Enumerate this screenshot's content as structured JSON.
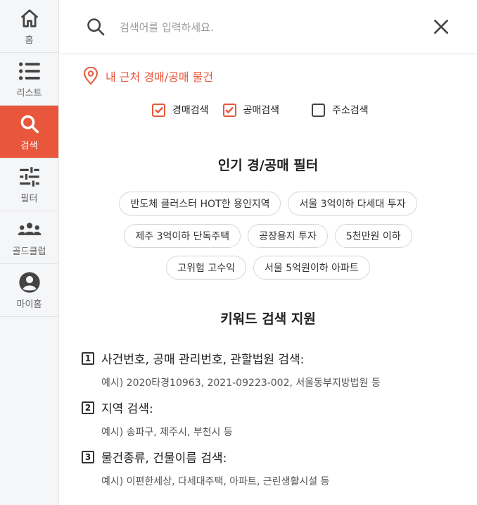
{
  "sidebar": {
    "items": [
      {
        "label": "홈",
        "icon": "home-icon"
      },
      {
        "label": "리스트",
        "icon": "list-icon"
      },
      {
        "label": "검색",
        "icon": "search-icon",
        "active": true
      },
      {
        "label": "필터",
        "icon": "filter-sliders-icon"
      },
      {
        "label": "골드클럽",
        "icon": "group-icon"
      },
      {
        "label": "마이홈",
        "icon": "user-circle-icon"
      }
    ],
    "accent_color": "#e8573c"
  },
  "search": {
    "placeholder": "검색어를 입력하세요.",
    "value": ""
  },
  "nearby": {
    "label": "내 근처 경매/공매 물건"
  },
  "checkboxes": [
    {
      "label": "경매검색",
      "checked": true
    },
    {
      "label": "공매검색",
      "checked": true
    },
    {
      "label": "주소검색",
      "checked": false
    }
  ],
  "popular": {
    "title": "인기 경/공매 필터",
    "chips": [
      [
        "반도체 클러스터 HOT한 용인지역",
        "서울 3억이하 다세대 투자"
      ],
      [
        "제주 3억이하 단독주택",
        "공장용지 투자",
        "5천만원 이하"
      ],
      [
        "고위험 고수익",
        "서울 5억원이하 아파트"
      ]
    ]
  },
  "keyword": {
    "title": "키워드 검색 지원",
    "items": [
      {
        "num": "1",
        "head": "사건번호, 공매 관리번호, 관할법원 검색:",
        "example": "예시) 2020타경10963, 2021-09223-002, 서울동부지방법원 등"
      },
      {
        "num": "2",
        "head": "지역 검색:",
        "example": "예시) 송파구, 제주시, 부천시 등"
      },
      {
        "num": "3",
        "head": "물건종류, 건물이름 검색:",
        "example": "예시) 이편한세상, 다세대주택, 아파트, 근린생활시설 등"
      }
    ]
  }
}
